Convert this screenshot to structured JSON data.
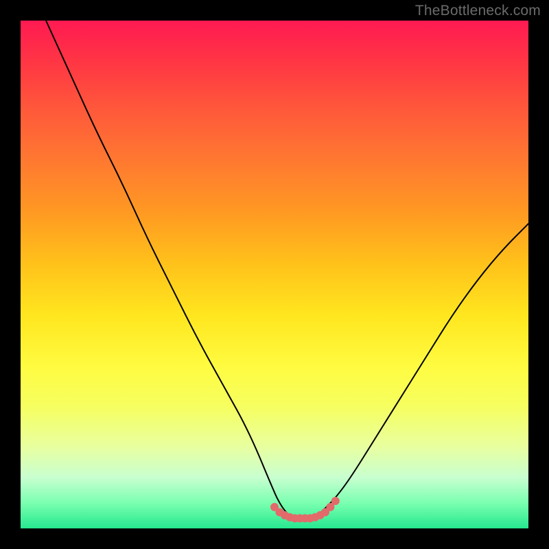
{
  "watermark": "TheBottleneck.com",
  "chart_data": {
    "type": "line",
    "title": "",
    "xlabel": "",
    "ylabel": "",
    "xlim": [
      0,
      100
    ],
    "ylim": [
      0,
      100
    ],
    "series": [
      {
        "name": "bottleneck-curve",
        "x": [
          5,
          10,
          15,
          20,
          25,
          30,
          35,
          40,
          45,
          50,
          51,
          52,
          53,
          54,
          55,
          56,
          57,
          58,
          59,
          60,
          62,
          65,
          70,
          75,
          80,
          85,
          90,
          95,
          100
        ],
        "values": [
          100,
          89,
          78,
          68,
          57,
          47,
          37,
          28,
          19,
          7,
          5,
          3.5,
          2.5,
          2,
          2,
          2,
          2,
          2.5,
          3,
          4,
          6,
          10,
          18,
          26,
          34,
          42,
          49,
          55,
          60
        ]
      }
    ],
    "colors": {
      "curve": "#000000",
      "markers": "#e26a6a",
      "gradient_top": "#ff1a52",
      "gradient_bottom": "#26e88f"
    },
    "markers": {
      "name": "trough-markers",
      "x": [
        50,
        51,
        52,
        53,
        54,
        55,
        56,
        57,
        58,
        59,
        60,
        61,
        62
      ],
      "values": [
        4.2,
        3.2,
        2.6,
        2.2,
        2,
        2,
        2,
        2,
        2.2,
        2.6,
        3.2,
        4.2,
        5.4
      ],
      "radius": 6
    }
  }
}
